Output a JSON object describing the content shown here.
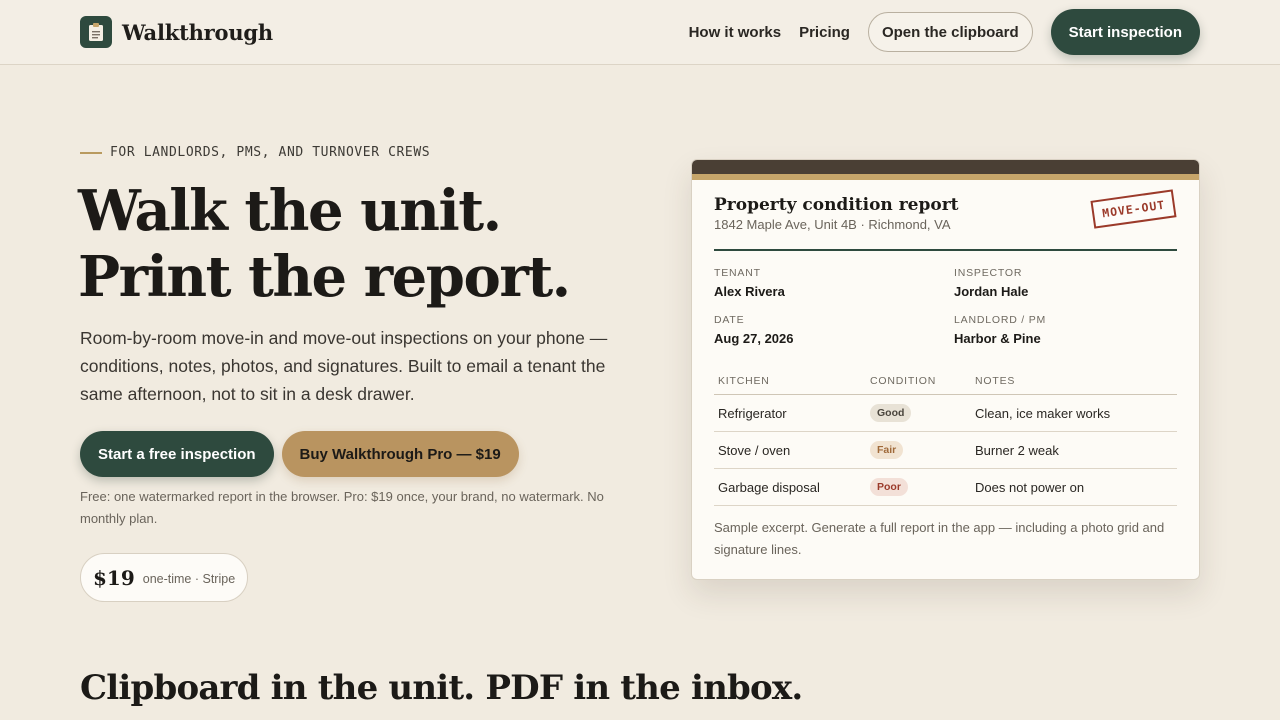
{
  "header": {
    "brand": "Walkthrough",
    "nav": {
      "how_it_works": "How it works",
      "pricing": "Pricing",
      "open_clipboard": "Open the clipboard",
      "start_inspection": "Start inspection"
    }
  },
  "hero": {
    "eyebrow": "FOR LANDLORDS, PMS, AND TURNOVER CREWS",
    "headline_line1": "Walk the unit.",
    "headline_line2": "Print the report.",
    "lede": "Room-by-room move-in and move-out inspections on your phone — conditions, notes, photos, and signatures. Built to email a tenant the same afternoon, not to sit in a desk drawer.",
    "cta_primary": "Start a free inspection",
    "cta_secondary": "Buy Walkthrough Pro — $19",
    "fineprint": "Free: one watermarked report in the browser. Pro: $19 once, your brand, no watermark. No monthly plan.",
    "price": "$19",
    "price_note": "one-time · Stripe"
  },
  "report": {
    "title": "Property condition report",
    "address": "1842 Maple Ave, Unit 4B · Richmond, VA",
    "stamp": "MOVE-OUT",
    "tenant_label": "TENANT",
    "tenant": "Alex Rivera",
    "inspector_label": "INSPECTOR",
    "inspector": "Jordan Hale",
    "date_label": "DATE",
    "date": "Aug 27, 2026",
    "landlord_label": "LANDLORD / PM",
    "landlord": "Harbor & Pine",
    "columns": {
      "room": "KITCHEN",
      "condition": "CONDITION",
      "notes": "NOTES"
    },
    "rows": [
      {
        "item": "Refrigerator",
        "condition": "Good",
        "notes": "Clean, ice maker works"
      },
      {
        "item": "Stove / oven",
        "condition": "Fair",
        "notes": "Burner 2 weak"
      },
      {
        "item": "Garbage disposal",
        "condition": "Poor",
        "notes": "Does not power on"
      }
    ],
    "footer": "Sample excerpt. Generate a full report in the app — including a photo grid and signature lines."
  },
  "section2_title": "Clipboard in the unit. PDF in the inbox.",
  "colors": {
    "background": "#f1ebe0",
    "brand_green": "#2e4a3e",
    "accent_tan": "#b99460",
    "stamp_red": "#9b3a2a",
    "badge_good_bg": "#e8e2d6",
    "badge_fair_bg": "#f1e3d1",
    "badge_poor_bg": "#f3e0d8"
  },
  "icons": {
    "logo": "clipboard-icon"
  }
}
